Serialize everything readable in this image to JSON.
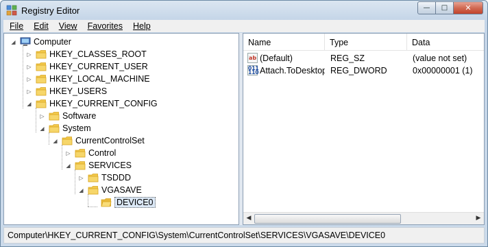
{
  "window": {
    "title": "Registry Editor",
    "controls": {
      "minimize": "—",
      "maximize": "□",
      "close": "✕"
    }
  },
  "menu": [
    {
      "label": "File"
    },
    {
      "label": "Edit"
    },
    {
      "label": "View"
    },
    {
      "label": "Favorites"
    },
    {
      "label": "Help"
    }
  ],
  "tree": [
    {
      "label": "Computer",
      "state": "expanded",
      "icon": "computer-icon"
    },
    {
      "label": "HKEY_CLASSES_ROOT",
      "state": "collapsed",
      "icon": "folder-icon"
    },
    {
      "label": "HKEY_CURRENT_USER",
      "state": "collapsed",
      "icon": "folder-icon"
    },
    {
      "label": "HKEY_LOCAL_MACHINE",
      "state": "collapsed",
      "icon": "folder-icon"
    },
    {
      "label": "HKEY_USERS",
      "state": "collapsed",
      "icon": "folder-icon"
    },
    {
      "label": "HKEY_CURRENT_CONFIG",
      "state": "expanded",
      "icon": "folder-icon"
    },
    {
      "label": "Software",
      "state": "collapsed",
      "icon": "folder-icon"
    },
    {
      "label": "System",
      "state": "expanded",
      "icon": "folder-icon"
    },
    {
      "label": "CurrentControlSet",
      "state": "expanded",
      "icon": "folder-icon"
    },
    {
      "label": "Control",
      "state": "collapsed",
      "icon": "folder-icon"
    },
    {
      "label": "SERVICES",
      "state": "expanded",
      "icon": "folder-icon"
    },
    {
      "label": "TSDDD",
      "state": "collapsed",
      "icon": "folder-icon"
    },
    {
      "label": "VGASAVE",
      "state": "expanded",
      "icon": "folder-icon"
    },
    {
      "label": "DEVICE0",
      "state": "leaf",
      "selected": true,
      "icon": "open-folder-icon"
    }
  ],
  "values": {
    "columns": [
      "Name",
      "Type",
      "Data"
    ],
    "rows": [
      {
        "icon": "string-value-icon",
        "name": "(Default)",
        "type": "REG_SZ",
        "data": "(value not set)"
      },
      {
        "icon": "dword-value-icon",
        "name": "Attach.ToDesktop",
        "type": "REG_DWORD",
        "data": "0x00000001 (1)"
      }
    ]
  },
  "status": {
    "path": "Computer\\HKEY_CURRENT_CONFIG\\System\\CurrentControlSet\\SERVICES\\VGASAVE\\DEVICE0"
  },
  "colors": {
    "folder": "#f2c94c",
    "folder_dark": "#d9a520",
    "selection": "#dbe8f6",
    "close_button": "#c2432b"
  }
}
